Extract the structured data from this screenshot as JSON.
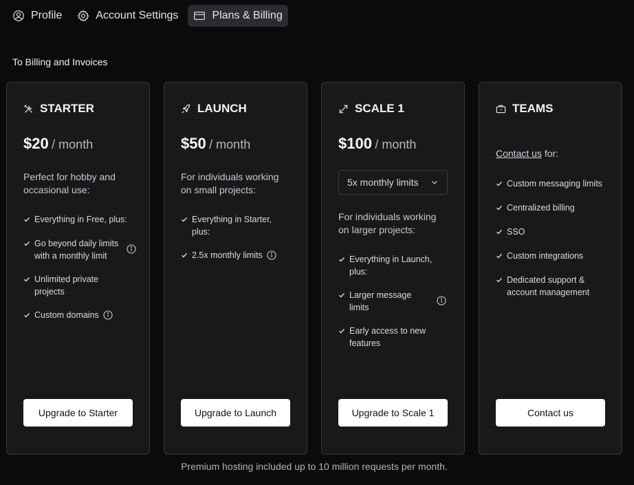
{
  "tabs": [
    {
      "label": "Profile",
      "icon": "user-circle-icon"
    },
    {
      "label": "Account Settings",
      "icon": "gear-icon"
    },
    {
      "label": "Plans & Billing",
      "icon": "credit-card-icon",
      "active": true
    }
  ],
  "billing_link": "To Billing and Invoices",
  "plans": [
    {
      "name": "STARTER",
      "icon": "tools-icon",
      "price": "$20",
      "period": "/ month",
      "description": "Perfect for hobby and occasional use:",
      "features": [
        "Everything in Free, plus:",
        "Go beyond daily limits with a monthly limit",
        "Unlimited private projects",
        "Custom domains"
      ],
      "button": "Upgrade to Starter"
    },
    {
      "name": "LAUNCH",
      "icon": "rocket-icon",
      "price": "$50",
      "period": "/ month",
      "description": "For individuals working on small projects:",
      "features": [
        "Everything in Starter, plus:",
        "2.5x monthly limits"
      ],
      "button": "Upgrade to Launch"
    },
    {
      "name": "SCALE 1",
      "icon": "expand-arrows-icon",
      "price": "$100",
      "period": "/ month",
      "select_value": "5x monthly limits",
      "description": "For individuals working on larger projects:",
      "features": [
        "Everything in Launch, plus:",
        "Larger message limits",
        "Early access to new features"
      ],
      "button": "Upgrade to Scale 1"
    },
    {
      "name": "TEAMS",
      "icon": "briefcase-icon",
      "contact_link": "Contact us",
      "contact_suffix": " for:",
      "features": [
        "Custom messaging limits",
        "Centralized billing",
        "SSO",
        "Custom integrations",
        "Dedicated support & account management"
      ],
      "button": "Contact us"
    }
  ],
  "footnote": "Premium hosting included up to 10 million requests per month."
}
